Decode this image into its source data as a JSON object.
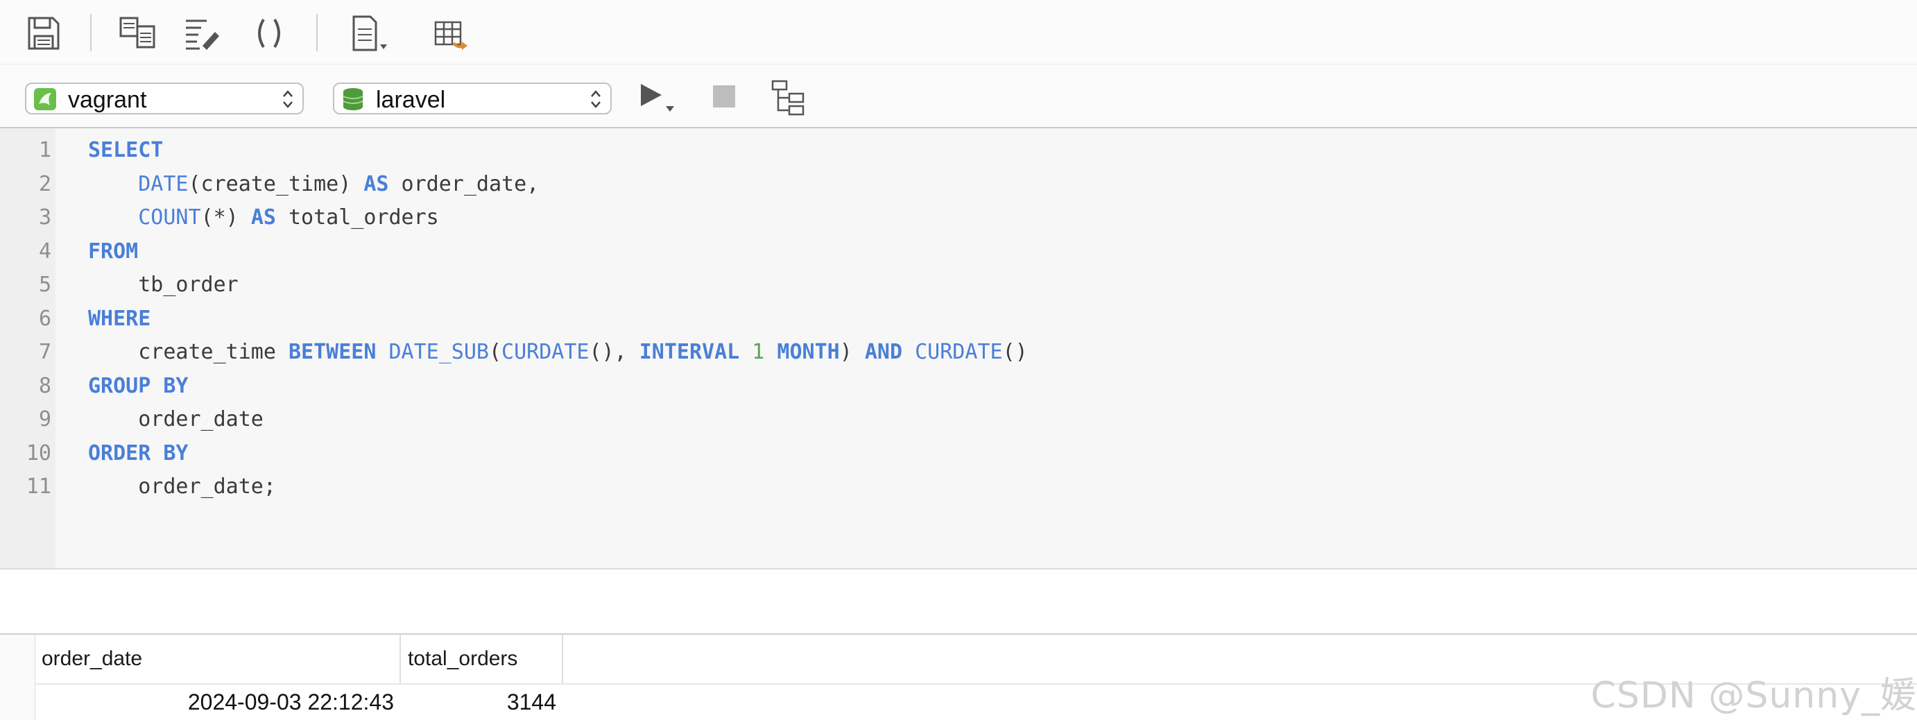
{
  "toolbar": {
    "buttons": [
      "save-icon",
      "query-builder-icon",
      "beautify-sql-icon",
      "parentheses-icon",
      "code-snippet-icon",
      "export-table-icon"
    ]
  },
  "connection": {
    "server": "vagrant",
    "database": "laravel",
    "server_icon_color": "#6abf4b",
    "database_icon_color": "#4e9a3c"
  },
  "editor": {
    "line_numbers": [
      "1",
      "2",
      "3",
      "4",
      "5",
      "6",
      "7",
      "8",
      "9",
      "10",
      "11"
    ],
    "lines": [
      [
        {
          "t": "kw",
          "v": "SELECT"
        }
      ],
      [
        {
          "t": "plain",
          "v": "    "
        },
        {
          "t": "fn",
          "v": "DATE"
        },
        {
          "t": "plain",
          "v": "(create_time) "
        },
        {
          "t": "kw",
          "v": "AS"
        },
        {
          "t": "plain",
          "v": " order_date,"
        }
      ],
      [
        {
          "t": "plain",
          "v": "    "
        },
        {
          "t": "fn",
          "v": "COUNT"
        },
        {
          "t": "plain",
          "v": "(*) "
        },
        {
          "t": "kw",
          "v": "AS"
        },
        {
          "t": "plain",
          "v": " total_orders"
        }
      ],
      [
        {
          "t": "kw",
          "v": "FROM"
        }
      ],
      [
        {
          "t": "plain",
          "v": "    tb_order"
        }
      ],
      [
        {
          "t": "kw",
          "v": "WHERE"
        }
      ],
      [
        {
          "t": "plain",
          "v": "    create_time "
        },
        {
          "t": "kw",
          "v": "BETWEEN"
        },
        {
          "t": "plain",
          "v": " "
        },
        {
          "t": "fn",
          "v": "DATE_SUB"
        },
        {
          "t": "plain",
          "v": "("
        },
        {
          "t": "fn",
          "v": "CURDATE"
        },
        {
          "t": "plain",
          "v": "(), "
        },
        {
          "t": "kw",
          "v": "INTERVAL"
        },
        {
          "t": "plain",
          "v": " "
        },
        {
          "t": "num",
          "v": "1"
        },
        {
          "t": "plain",
          "v": " "
        },
        {
          "t": "kw",
          "v": "MONTH"
        },
        {
          "t": "plain",
          "v": ") "
        },
        {
          "t": "kw",
          "v": "AND"
        },
        {
          "t": "plain",
          "v": " "
        },
        {
          "t": "fn",
          "v": "CURDATE"
        },
        {
          "t": "plain",
          "v": "()"
        }
      ],
      [
        {
          "t": "kw",
          "v": "GROUP BY"
        }
      ],
      [
        {
          "t": "plain",
          "v": "    order_date"
        }
      ],
      [
        {
          "t": "kw",
          "v": "ORDER BY"
        }
      ],
      [
        {
          "t": "plain",
          "v": "    order_date;"
        }
      ]
    ]
  },
  "results": {
    "columns": [
      "order_date",
      "total_orders"
    ],
    "rows": [
      [
        "2024-09-03 22:12:43",
        "3144"
      ]
    ]
  },
  "watermark": "CSDN @Sunny_媛"
}
